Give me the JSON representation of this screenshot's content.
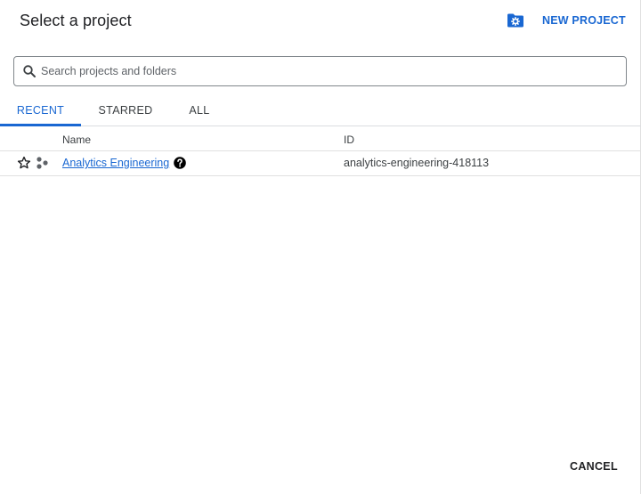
{
  "dialog": {
    "title": "Select a project",
    "new_project_label": "NEW PROJECT",
    "cancel_label": "CANCEL",
    "accent_color": "#1967d2"
  },
  "search": {
    "placeholder": "Search projects and folders",
    "value": ""
  },
  "tabs": [
    {
      "label": "RECENT",
      "active": true
    },
    {
      "label": "STARRED",
      "active": false
    },
    {
      "label": "ALL",
      "active": false
    }
  ],
  "table": {
    "columns": [
      "Name",
      "ID"
    ],
    "rows": [
      {
        "name": "Analytics Engineering",
        "id": "analytics-engineering-418113",
        "starred": false,
        "icons": [
          "star-outline-icon",
          "organization-icon",
          "help-icon"
        ]
      }
    ]
  }
}
